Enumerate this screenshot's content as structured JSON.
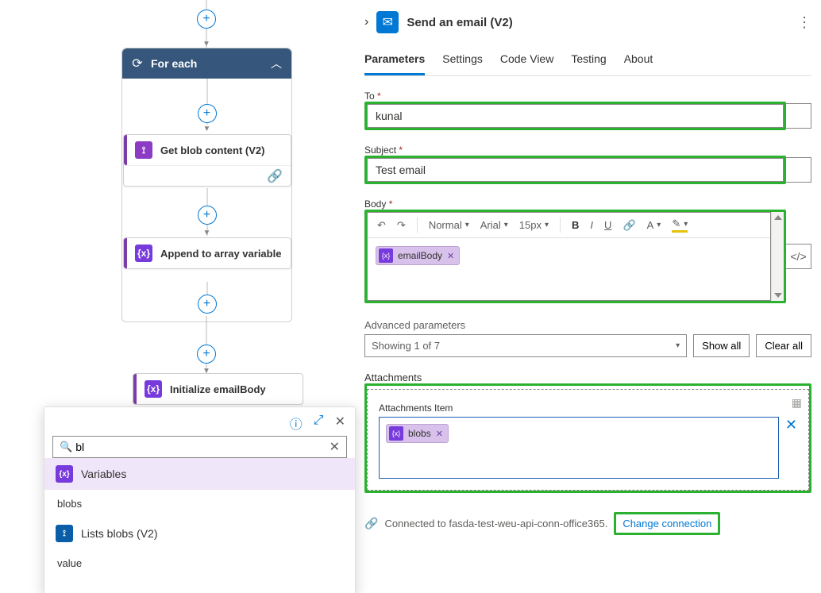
{
  "flow": {
    "foreach_label": "For each",
    "get_blob": "Get blob content (V2)",
    "append_var": "Append to array variable",
    "init_email": "Initialize emailBody"
  },
  "flyout": {
    "search_value": "bl",
    "variables_header": "Variables",
    "item_blobs": "blobs",
    "lists_blobs": "Lists blobs (V2)",
    "item_value": "value"
  },
  "panel": {
    "title": "Send an email (V2)",
    "tabs": {
      "parameters": "Parameters",
      "settings": "Settings",
      "codeview": "Code View",
      "testing": "Testing",
      "about": "About"
    },
    "to_label": "To",
    "to_value": "kunal",
    "subject_label": "Subject",
    "subject_value": "Test email",
    "body_label": "Body",
    "toolbar": {
      "normal": "Normal",
      "font": "Arial",
      "size": "15px"
    },
    "body_token": "emailBody",
    "adv_label": "Advanced parameters",
    "adv_select": "Showing 1 of 7",
    "showall": "Show all",
    "clearall": "Clear all",
    "attach_label": "Attachments",
    "attach_item_label": "Attachments Item",
    "attach_token": "blobs",
    "connected_text": "Connected to fasda-test-weu-api-conn-office365.",
    "change_conn": "Change connection"
  }
}
